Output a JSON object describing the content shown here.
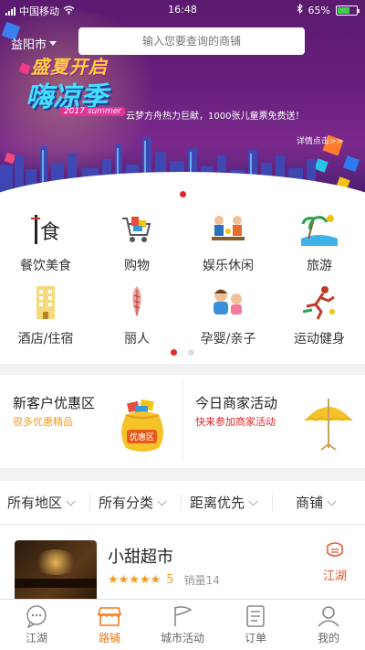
{
  "status_bar": {
    "carrier": "中国移动",
    "time": "16:48",
    "battery": "65%",
    "battery_level": 0.65
  },
  "header": {
    "city": "益阳市",
    "search_placeholder": "输入您要查询的商铺"
  },
  "banner": {
    "logo_line1": "盛夏开启",
    "logo_line2": "嗨凉季",
    "logo_line3": "2017 summer",
    "promo_text": "云梦方舟热力巨献，1000张儿童票免费送！",
    "detail_link": "详情点击>>"
  },
  "categories": [
    {
      "label": "餐饮美食",
      "icon": "food-icon"
    },
    {
      "label": "购物",
      "icon": "shopping-cart-icon"
    },
    {
      "label": "娱乐休闲",
      "icon": "entertainment-icon"
    },
    {
      "label": "旅游",
      "icon": "travel-icon"
    },
    {
      "label": "酒店/住宿",
      "icon": "hotel-icon"
    },
    {
      "label": "丽人",
      "icon": "beauty-icon"
    },
    {
      "label": "孕婴/亲子",
      "icon": "baby-icon"
    },
    {
      "label": "运动健身",
      "icon": "sports-icon"
    }
  ],
  "promo_cards": [
    {
      "title": "新客户优惠区",
      "subtitle": "很多优惠精品",
      "subtitle_color": "#f39a1e",
      "badge": "优惠区"
    },
    {
      "title": "今日商家活动",
      "subtitle": "快来参加商家活动",
      "subtitle_color": "#e0262d"
    }
  ],
  "filters": [
    {
      "label": "所有地区"
    },
    {
      "label": "所有分类"
    },
    {
      "label": "距离优先"
    },
    {
      "label": "商铺"
    }
  ],
  "store": {
    "name": "小甜超市",
    "rating": "5",
    "sales": "销量14",
    "tag": "江湖",
    "stars": 5
  },
  "tabbar": [
    {
      "label": "江湖",
      "icon": "chat-bubble-icon"
    },
    {
      "label": "路铺",
      "icon": "shop-icon"
    },
    {
      "label": "城市活动",
      "icon": "flag-icon"
    },
    {
      "label": "订单",
      "icon": "order-list-icon"
    },
    {
      "label": "我的",
      "icon": "user-icon"
    }
  ],
  "colors": {
    "accent": "#f07a1a",
    "red": "#e0262d",
    "banner_purple": "#6b1f7e"
  }
}
